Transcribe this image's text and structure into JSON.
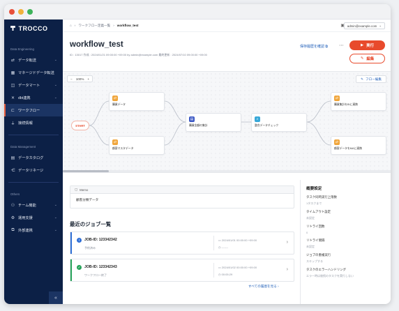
{
  "window": {
    "dots": [
      "#e8503a",
      "#f1b23c",
      "#3db35a"
    ]
  },
  "sidebar": {
    "logo": "TROCCO",
    "sections": [
      {
        "title": "Data Engineering",
        "items": [
          {
            "label": "データ転送",
            "icon": "transfer-icon",
            "chevron": "⌄"
          },
          {
            "label": "マネージドデータ転送",
            "icon": "grid-icon",
            "chevron": ""
          },
          {
            "label": "データマート",
            "icon": "database-icon",
            "chevron": "⌄"
          },
          {
            "label": "dbt連携",
            "icon": "dbt-icon",
            "chevron": "⌄"
          },
          {
            "label": "ワークフロー",
            "icon": "workflow-icon",
            "chevron": "",
            "active": true
          },
          {
            "label": "接続情報",
            "icon": "plug-icon",
            "chevron": ""
          }
        ]
      },
      {
        "title": "Data Management",
        "items": [
          {
            "label": "データカタログ",
            "icon": "catalog-icon",
            "chevron": ""
          },
          {
            "label": "データリネージ",
            "icon": "lineage-icon",
            "chevron": ""
          }
        ]
      },
      {
        "title": "Others",
        "items": [
          {
            "label": "チーム機能",
            "icon": "team-icon",
            "chevron": "⌄"
          },
          {
            "label": "運用支援",
            "icon": "ops-icon",
            "chevron": "⌄"
          },
          {
            "label": "外部連携",
            "icon": "external-icon",
            "chevron": "⌄"
          }
        ]
      }
    ],
    "collapse_glyph": "«"
  },
  "topbar": {
    "breadcrumb": [
      "ワークフロー定義一覧",
      "workflow_test"
    ],
    "user": "admin@example.com"
  },
  "header": {
    "title": "workflow_test",
    "meta": "ID : 13017    作成 : 2024/01/21 09:00:00 +09:00  by admin@example.com      最終更新 : 2024/07/10 09:00:00 +09:00",
    "version_link": "保存履歴を確認",
    "run_label": "実行",
    "edit_label": "編集"
  },
  "canvas": {
    "zoom": "100%",
    "flow_edit": "フロー編集",
    "start_label": "START",
    "nodes": [
      {
        "label": "購買データ",
        "color": "#f0a53a"
      },
      {
        "label": "顧客マスタデータ",
        "color": "#f0a53a"
      },
      {
        "label": "購買金額の集計",
        "color": "#3b58c4"
      },
      {
        "label": "整合データチェック",
        "color": "#38a8d8"
      },
      {
        "label": "購買集計をBIに連携",
        "color": "#f0a53a"
      },
      {
        "label": "顧客データをMAに連携",
        "color": "#f0a53a"
      }
    ]
  },
  "memo": {
    "title": "Memo",
    "body": "顧客分類データ"
  },
  "jobs": {
    "title": "最近のジョブ一覧",
    "items": [
      {
        "id": "JOB-ID: 123342342",
        "status": "予約済み",
        "start": "2024/01/01 00:00:00 +09:00",
        "duration": "-------",
        "color": "#2f6fd6",
        "icon": "i"
      },
      {
        "id": "JOB-ID: 123342343",
        "status": "ワークフロー終了",
        "start": "2024/01/02 00:00:00 +09:00",
        "duration": "00:05:29",
        "color": "#27a35a",
        "icon": "✓"
      }
    ],
    "see_all": "すべての履歴を見る"
  },
  "settings": {
    "title": "概要設定",
    "items": [
      {
        "label": "タスク同時実行上限数",
        "value": "1タスクまで"
      },
      {
        "label": "タイムアウト設定",
        "value": "未設定"
      },
      {
        "label": "リトライ回数",
        "value": "0"
      },
      {
        "label": "リトライ間隔",
        "value": "未設定"
      },
      {
        "label": "ジョブの重複実行",
        "value": "スキップする"
      },
      {
        "label": "タスクのエラーハンドリング",
        "value": "エラー時は後続のタスクを実行しない"
      }
    ]
  }
}
